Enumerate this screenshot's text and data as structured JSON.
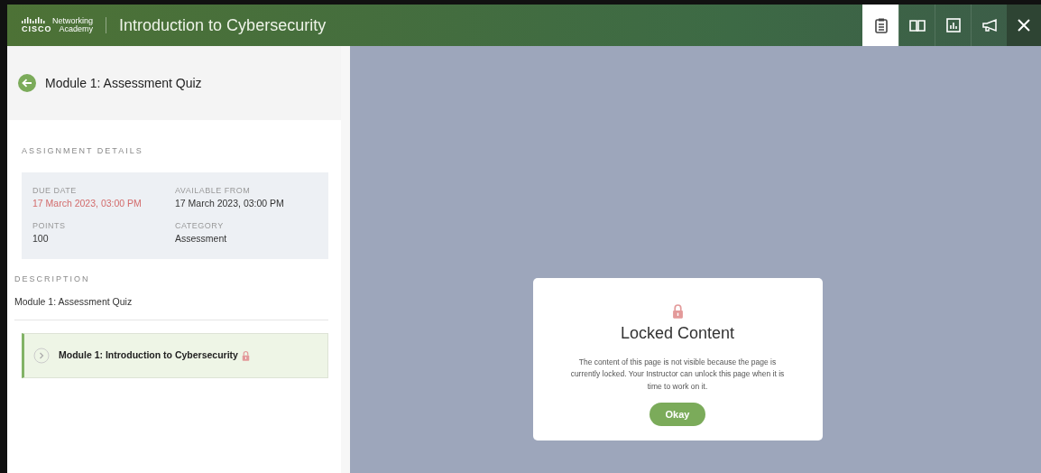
{
  "header": {
    "logo": {
      "top": "Networking",
      "brand": "CISCO",
      "bottom": "Academy"
    },
    "title": "Introduction to Cybersecurity",
    "tabs": [
      {
        "kind": "clipboard",
        "selected": true
      },
      {
        "kind": "book",
        "selected": false
      },
      {
        "kind": "chart",
        "selected": false
      },
      {
        "kind": "megaphone",
        "selected": false
      }
    ]
  },
  "sidebar": {
    "title": "Module 1: Assessment Quiz",
    "section": "ASSIGNMENT DETAILS",
    "details": [
      {
        "label": "DUE DATE",
        "value": "17 March 2023, 03:00 PM",
        "overdue": true
      },
      {
        "label": "AVAILABLE FROM",
        "value": "17 March 2023, 03:00 PM",
        "overdue": false
      },
      {
        "label": "POINTS",
        "value": "100",
        "overdue": false
      },
      {
        "label": "CATEGORY",
        "value": "Assessment",
        "overdue": false
      }
    ],
    "description_heading": "DESCRIPTION",
    "description": "Module 1: Assessment Quiz",
    "modules": [
      {
        "title": "Module 1: Introduction to Cybersecurity",
        "locked": true
      }
    ]
  },
  "dialog": {
    "title": "Locked Content",
    "message": "The content of this page is not visible because the page is currently locked. Your Instructor can unlock this page when it is time to work on it.",
    "button": "Okay"
  }
}
